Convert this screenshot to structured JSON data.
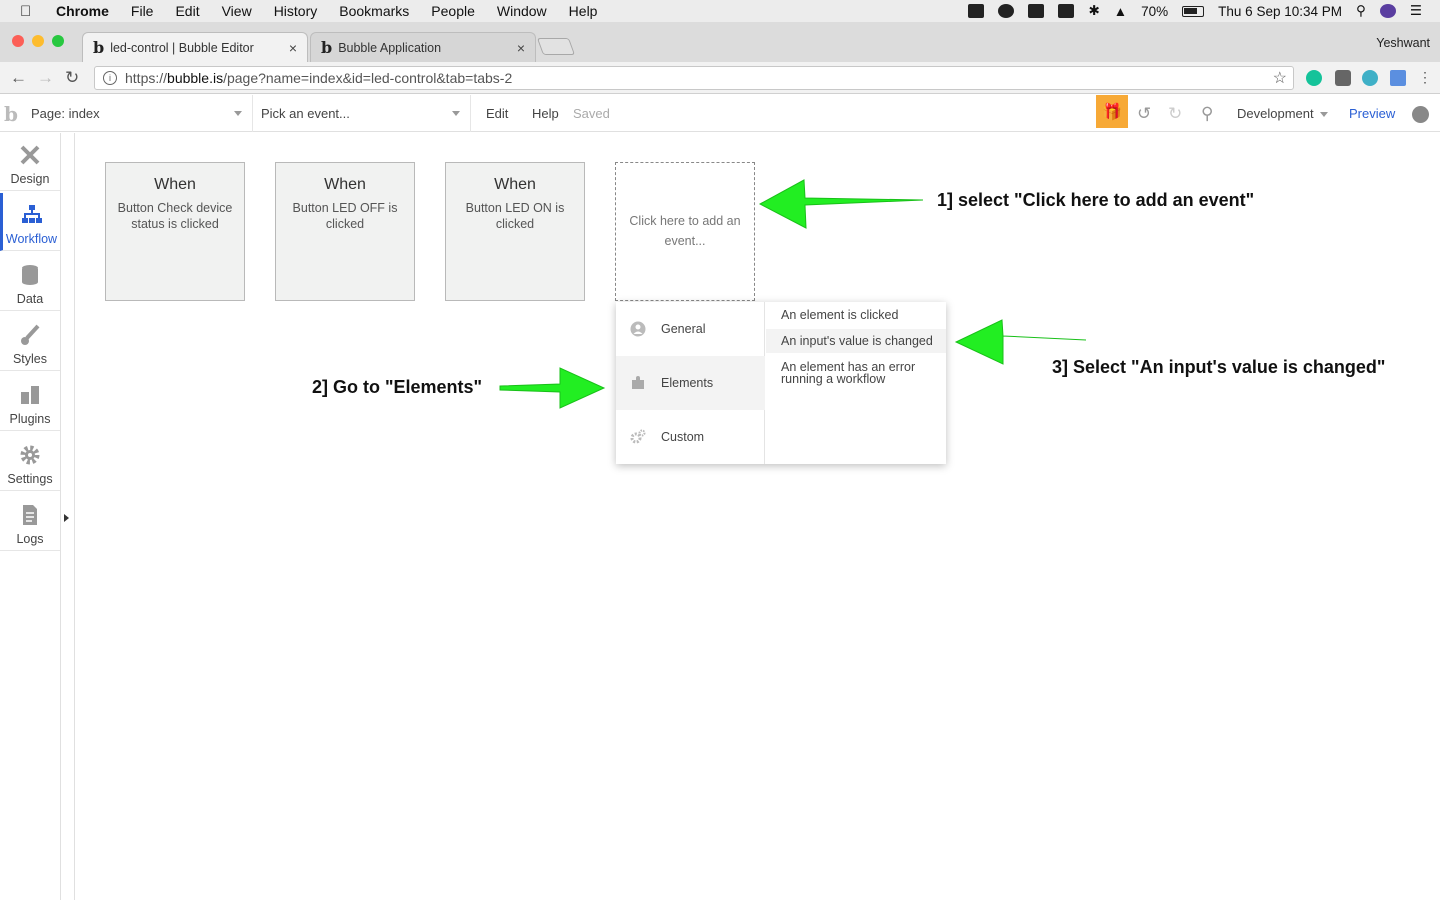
{
  "menubar": {
    "app": "Chrome",
    "items": [
      "File",
      "Edit",
      "View",
      "History",
      "Bookmarks",
      "People",
      "Window",
      "Help"
    ],
    "battery": "70%",
    "clock": "Thu 6 Sep  10:34 PM"
  },
  "tabs": [
    {
      "title": "led-control | Bubble Editor",
      "favicon": "b",
      "close": "×"
    },
    {
      "title": "Bubble Application",
      "favicon": "b",
      "close": "×"
    }
  ],
  "profile": "Yeshwant",
  "omnibox": {
    "url_prefix": "https://",
    "url_host": "bubble.is",
    "url_path": "/page?name=index&id=led-control&tab=tabs-2"
  },
  "toolbar": {
    "logo": "b",
    "page_select": "Page: index",
    "event_select": "Pick an event...",
    "edit": "Edit",
    "help": "Help",
    "saved": "Saved",
    "environment": "Development",
    "preview": "Preview"
  },
  "sidebar": [
    {
      "label": "Design",
      "icon": "design-icon"
    },
    {
      "label": "Workflow",
      "icon": "workflow-icon"
    },
    {
      "label": "Data",
      "icon": "data-icon"
    },
    {
      "label": "Styles",
      "icon": "styles-icon"
    },
    {
      "label": "Plugins",
      "icon": "plugins-icon"
    },
    {
      "label": "Settings",
      "icon": "settings-icon"
    },
    {
      "label": "Logs",
      "icon": "logs-icon"
    }
  ],
  "events": [
    {
      "when": "When",
      "desc": "Button Check device status is clicked"
    },
    {
      "when": "When",
      "desc": "Button LED OFF is clicked"
    },
    {
      "when": "When",
      "desc": "Button LED ON is clicked"
    }
  ],
  "add_event": "Click here to add an event...",
  "dropdown": {
    "categories": [
      "General",
      "Elements",
      "Custom"
    ],
    "options": [
      "An element is clicked",
      "An input's value is changed",
      "An element has an error running a workflow"
    ]
  },
  "annotations": {
    "step1": "1] select \"Click here to add an event\"",
    "step2": "2] Go to \"Elements\"",
    "step3": "3] Select \"An input's value is changed\""
  },
  "colors": {
    "accent": "#2a5fd4",
    "gift": "#f7a936",
    "arrow": "#22ee22"
  }
}
